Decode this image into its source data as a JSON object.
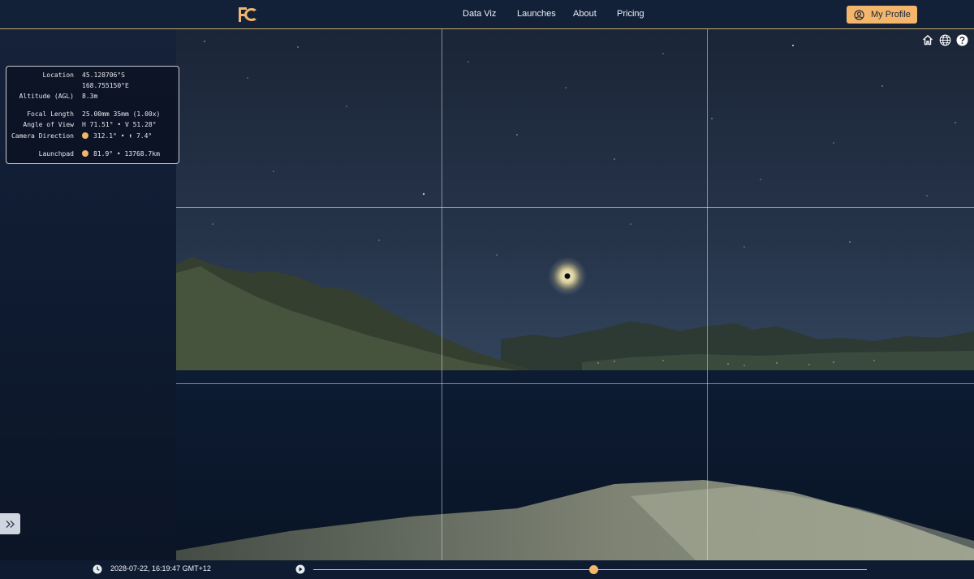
{
  "header": {
    "nav": [
      {
        "label": "Data Viz"
      },
      {
        "label": "Launches"
      },
      {
        "label": "About"
      },
      {
        "label": "Pricing"
      }
    ],
    "profile_label": "My Profile"
  },
  "info": {
    "location_label": "Location",
    "latitude": "45.128706°S",
    "longitude": "168.755150°E",
    "altitude_label": "Altitude (AGL)",
    "altitude": "8.3m",
    "focal_label": "Focal Length",
    "focal": "25.00mm 35mm (1.00x)",
    "aov_label": "Angle of View",
    "aov": "H 71.51° • V 51.28°",
    "camera_label": "Camera Direction",
    "camera": "312.1° • ⬆ 7.4°",
    "launchpad_label": "Launchpad",
    "launchpad": "81.9° • 13768.7km"
  },
  "view_controls": [
    {
      "icon": "home-icon"
    },
    {
      "icon": "globe-icon"
    },
    {
      "icon": "help-icon"
    }
  ],
  "timeline": {
    "datetime": "2028-07-22, 16:19:47 GMT+12",
    "progress": 0.507
  },
  "colors": {
    "accent": "#f3b66b",
    "nav_bg": "#122038",
    "panel_border": "#c9cdd4"
  }
}
